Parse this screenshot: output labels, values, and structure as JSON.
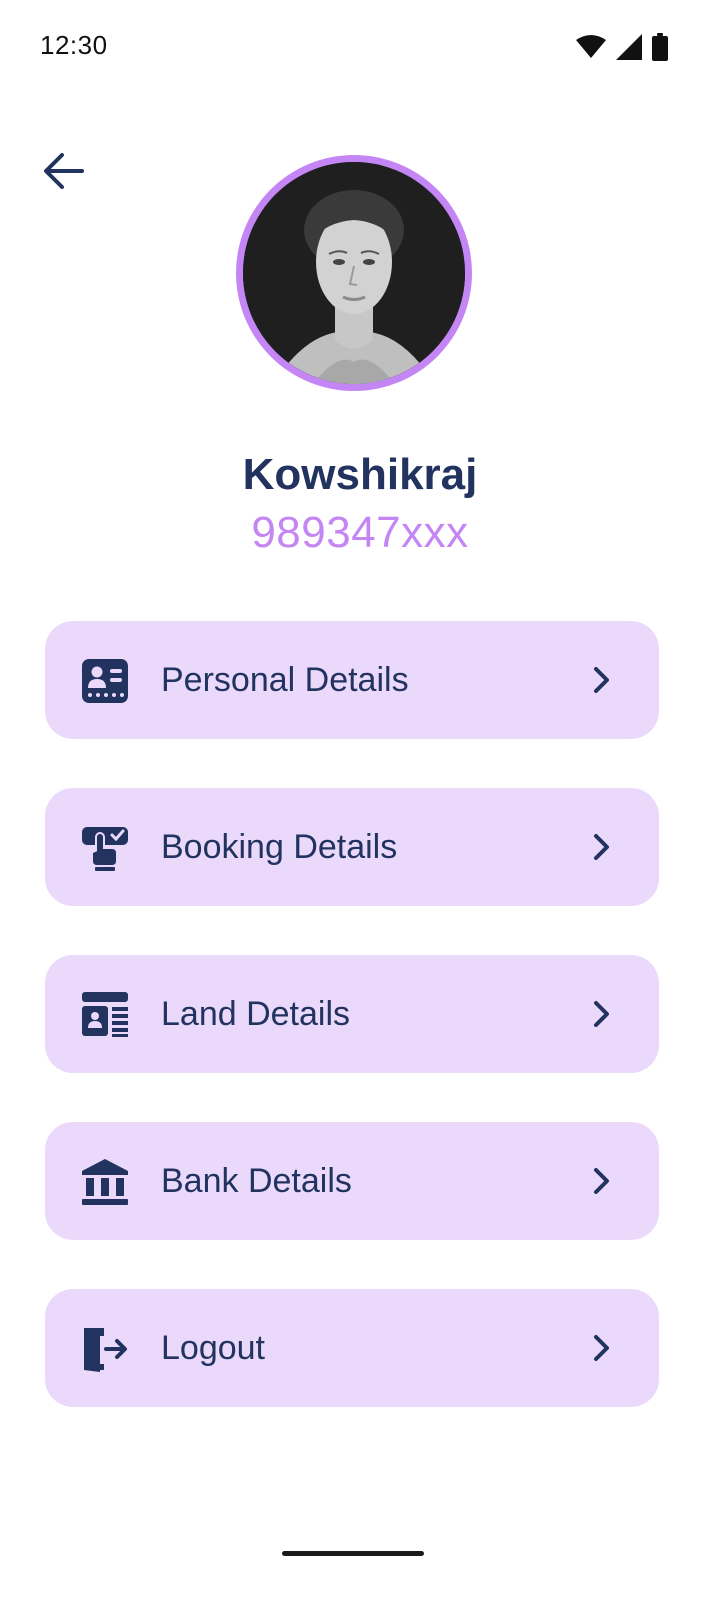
{
  "status_bar": {
    "time": "12:30",
    "icons": [
      "wifi-icon",
      "signal-icon",
      "battery-icon"
    ]
  },
  "header": {
    "back_icon": "arrow-left-icon"
  },
  "profile": {
    "name": "Kowshikraj",
    "phone": "989347xxx",
    "avatar_ring_color": "#c586f5"
  },
  "menu": {
    "items": [
      {
        "label": "Personal Details",
        "icon": "id-card-icon"
      },
      {
        "label": "Booking Details",
        "icon": "booking-hand-icon"
      },
      {
        "label": "Land Details",
        "icon": "land-document-icon"
      },
      {
        "label": "Bank Details",
        "icon": "bank-icon"
      },
      {
        "label": "Logout",
        "icon": "logout-icon"
      }
    ],
    "chevron_icon": "chevron-right-icon"
  },
  "colors": {
    "primary": "#22335f",
    "accent": "#c586f5",
    "card_bg": "#ead9fb",
    "background": "#ffffff"
  }
}
